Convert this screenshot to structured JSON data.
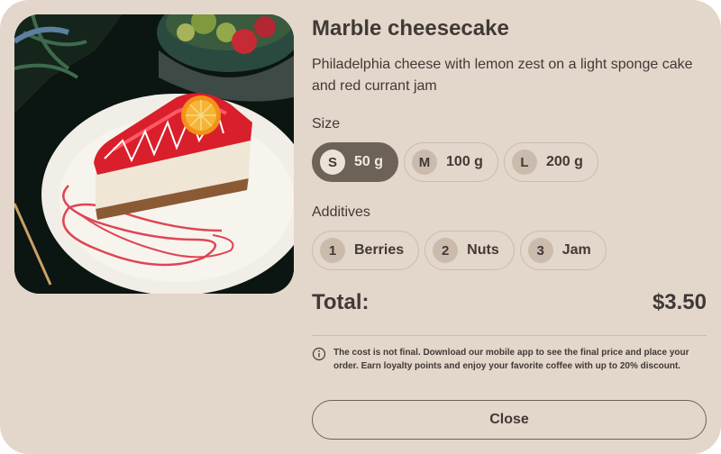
{
  "product": {
    "title": "Marble cheesecake",
    "description": "Philadelphia cheese with lemon zest on a light sponge cake and red currant jam",
    "image_alt": "Slice of marble cheesecake with red jelly topping and orange slice on a white plate"
  },
  "size": {
    "label": "Size",
    "options": [
      {
        "badge": "S",
        "value": "50 g",
        "selected": true
      },
      {
        "badge": "M",
        "value": "100 g",
        "selected": false
      },
      {
        "badge": "L",
        "value": "200 g",
        "selected": false
      }
    ]
  },
  "additives": {
    "label": "Additives",
    "options": [
      {
        "badge": "1",
        "value": "Berries"
      },
      {
        "badge": "2",
        "value": "Nuts"
      },
      {
        "badge": "3",
        "value": "Jam"
      }
    ]
  },
  "total": {
    "label": "Total:",
    "amount": "$3.50"
  },
  "note": {
    "icon": "info-icon",
    "text": "The cost is not final. Download our mobile app to see the final price and place your order. Earn loyalty points and enjoy your favorite coffee with up to 20% discount."
  },
  "actions": {
    "close_label": "Close"
  },
  "colors": {
    "background": "#e3d6ca",
    "accent": "#6d6258",
    "border": "#cbbbad",
    "text": "#403a36"
  }
}
